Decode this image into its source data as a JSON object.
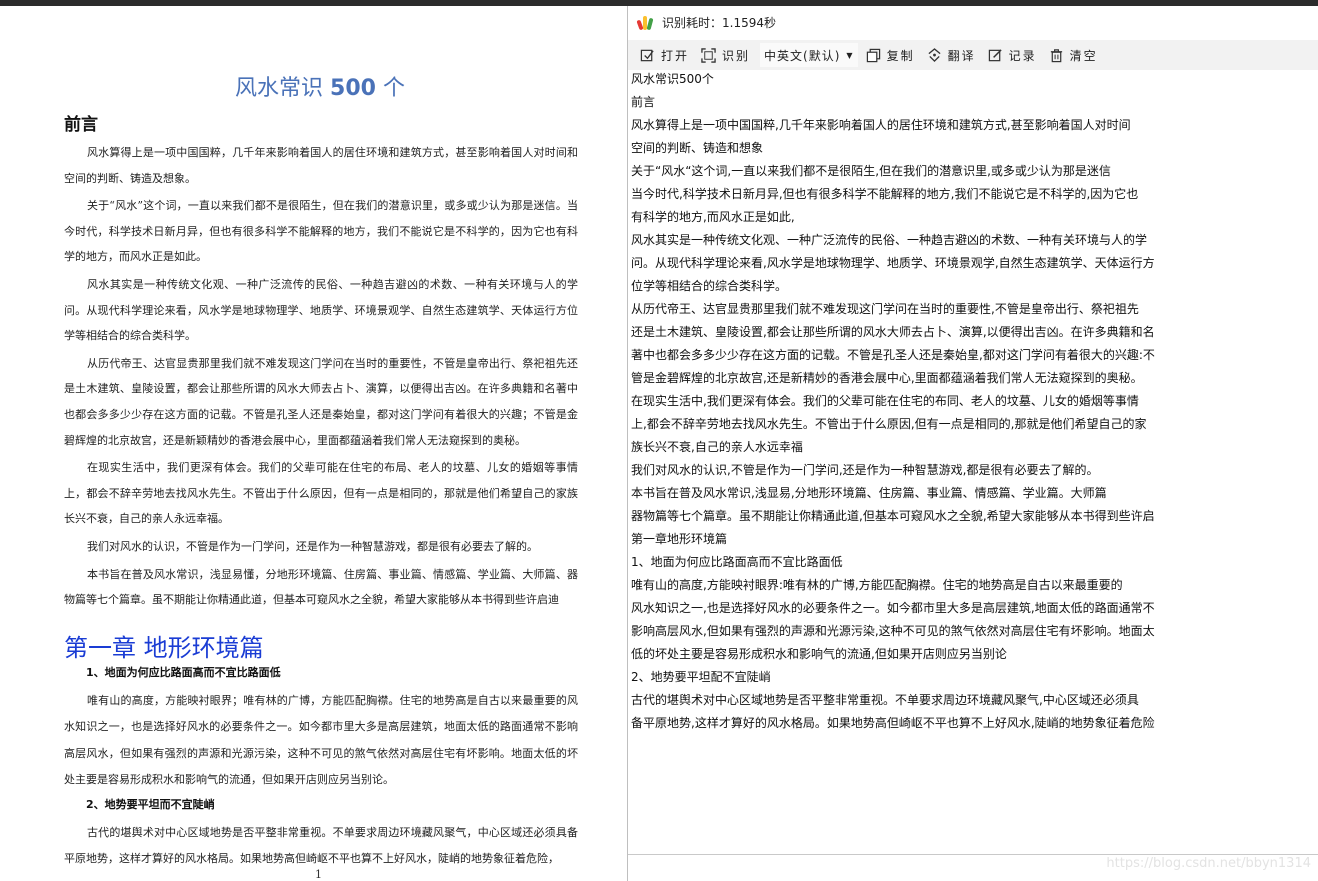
{
  "document": {
    "title_prefix": "风水常识 ",
    "title_number": "500",
    "title_suffix": " 个",
    "preface_heading": "前言",
    "paragraphs": [
      "风水算得上是一项中国国粹，几千年来影响着国人的居住环境和建筑方式，甚至影响着国人对时间和空间的判断、铸造及想象。",
      "关于“风水”这个词，一直以来我们都不是很陌生，但在我们的潜意识里，或多或少认为那是迷信。当今时代，科学技术日新月异，但也有很多科学不能解释的地方，我们不能说它是不科学的，因为它也有科学的地方，而风水正是如此。",
      "风水其实是一种传统文化观、一种广泛流传的民俗、一种趋吉避凶的术数、一种有关环境与人的学问。从现代科学理论来看，风水学是地球物理学、地质学、环境景观学、自然生态建筑学、天体运行方位学等相结合的综合类科学。",
      "从历代帝王、达官显贵那里我们就不难发现这门学问在当时的重要性，不管是皇帝出行、祭祀祖先还是土木建筑、皇陵设置，都会让那些所谓的风水大师去占卜、演算，以便得出吉凶。在许多典籍和名著中也都会多多少少存在这方面的记载。不管是孔圣人还是秦始皇，都对这门学问有着很大的兴趣；不管是金碧辉煌的北京故宫，还是新颖精妙的香港会展中心，里面都蕴涵着我们常人无法窥探到的奥秘。",
      "在现实生活中，我们更深有体会。我们的父辈可能在住宅的布局、老人的坟墓、儿女的婚姻等事情上，都会不辞辛劳地去找风水先生。不管出于什么原因，但有一点是相同的，那就是他们希望自己的家族长兴不衰，自己的亲人永远幸福。",
      "我们对风水的认识，不管是作为一门学问，还是作为一种智慧游戏，都是很有必要去了解的。",
      "本书旨在普及风水常识，浅显易懂，分地形环境篇、住房篇、事业篇、情感篇、学业篇、大师篇、器物篇等七个篇章。虽不期能让你精通此道，但基本可窥风水之全貌，希望大家能够从本书得到些许启迪"
    ],
    "chapter_heading": "第一章  地形环境篇",
    "section1_heading": "1、地面为何应比路面高而不宜比路面低",
    "section1_text": "唯有山的高度，方能映衬眼界；唯有林的广博，方能匹配胸襟。住宅的地势高是自古以来最重要的风水知识之一，也是选择好风水的必要条件之一。如今都市里大多是高层建筑，地面太低的路面通常不影响高层风水，但如果有强烈的声源和光源污染，这种不可见的煞气依然对高层住宅有坏影响。地面太低的坏处主要是容易形成积水和影响气的流通，但如果开店则应另当别论。",
    "section2_heading": "2、地势要平坦而不宜陡峭",
    "section2_text": "古代的堪舆术对中心区域地势是否平整非常重视。不单要求周边环境藏风聚气，中心区域还必须具备平原地势，这样才算好的风水格局。如果地势高但崎岖不平也算不上好风水，陡峭的地势象征着危险，",
    "page_number": "1"
  },
  "window": {
    "title": "识别耗时：1.1594秒",
    "toolbar": {
      "open": "打开",
      "recognize": "识别",
      "language": "中英文(默认)",
      "copy": "复制",
      "translate": "翻译",
      "record": "记录",
      "clear": "清空"
    },
    "result_lines": [
      "风水常识500个",
      "前言",
      "风水算得上是一项中国国粹,几千年来影响着国人的居住环境和建筑方式,甚至影响着国人对时间",
      "空间的判断、铸造和想象",
      "关于“风水“这个词,一直以来我们都不是很陌生,但在我们的潜意识里,或多或少认为那是迷信",
      "当今时代,科学技术日新月异,但也有很多科学不能解释的地方,我们不能说它是不科学的,因为它也",
      "有科学的地方,而风水正是如此,",
      "风水其实是一种传统文化观、一种广泛流传的民俗、一种趋吉避凶的术数、一种有关环境与人的学",
      "问。从现代科学理论来看,风水学是地球物理学、地质学、环境景观学,自然生态建筑学、天体运行方",
      "位学等相结合的综合类科学。",
      "从历代帝王、达官显贵那里我们就不难发现这门学问在当时的重要性,不管是皇帝出行、祭祀祖先",
      "还是土木建筑、皇陵设置,都会让那些所谓的风水大师去占卜、演算,以便得出吉凶。在许多典籍和名",
      "著中也都会多多少少存在这方面的记载。不管是孔圣人还是秦始皇,都对这门学问有着很大的兴趣:不",
      "管是金碧辉煌的北京故宫,还是新精妙的香港会展中心,里面都蕴涵着我们常人无法窥探到的奥秘。",
      "在现实生活中,我们更深有体会。我们的父辈可能在住宅的布同、老人的坟墓、儿女的婚烟等事情",
      "上,都会不辞辛劳地去找风水先生。不管出于什么原因,但有一点是相同的,那就是他们希望自己的家",
      "族长兴不衰,自己的亲人水远幸福",
      "我们对风水的认识,不管是作为一门学问,还是作为一种智慧游戏,都是很有必要去了解的。",
      "本书旨在普及风水常识,浅显易,分地形环境篇、住房篇、事业篇、情感篇、学业篇。大师篇",
      "器物篇等七个篇章。虽不期能让你精通此道,但基本可窥风水之全貌,希望大家能够从本书得到些许启",
      "第一章地形环境篇",
      "1、地面为何应比路面高而不宜比路面低",
      "唯有山的高度,方能映衬眼界:唯有林的广博,方能匹配胸襟。住宅的地势高是自古以来最重要的",
      "风水知识之一,也是选择好风水的必要条件之一。如今都市里大多是高层建筑,地面太低的路面通常不",
      "影响高层风水,但如果有强烈的声源和光源污染,这种不可见的煞气依然对高层住宅有坏影响。地面太",
      "低的坏处主要是容易形成积水和影响气的流通,但如果开店则应另当别论",
      "2、地势要平坦配不宜陡峭",
      "古代的堪舆术对中心区域地势是否平整非常重视。不单要求周边环境藏风聚气,中心区域还必须具",
      "备平原地势,这样才算好的风水格局。如果地势高但崎岖不平也算不上好风水,陡峭的地势象征着危险"
    ]
  },
  "watermark": "https://blog.csdn.net/bbyn1314",
  "colors": {
    "doc_title": "#4a72b8",
    "chapter": "#1a3cd4",
    "toolbar_bg": "#f2f2f2"
  }
}
